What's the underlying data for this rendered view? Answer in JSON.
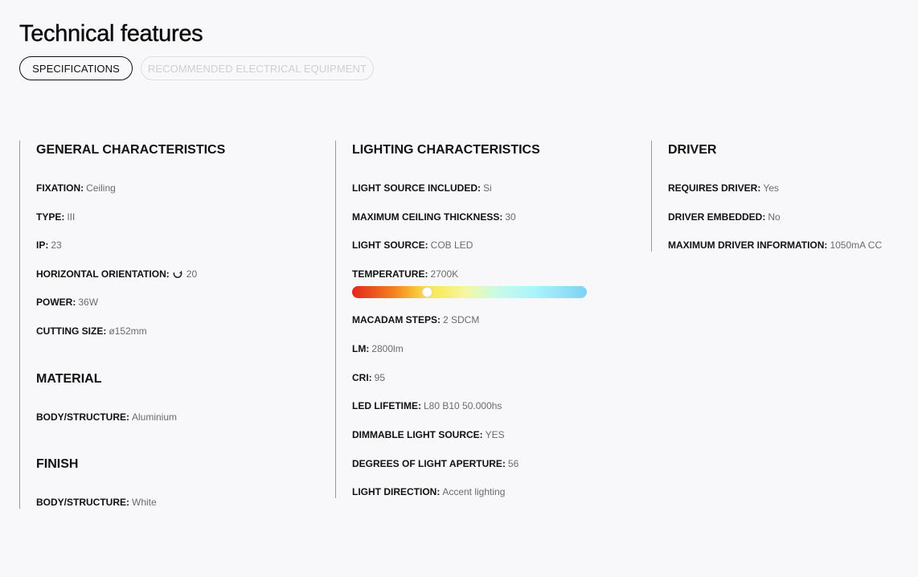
{
  "header": {
    "title": "Technical features"
  },
  "tabs": [
    {
      "label": "SPECIFICATIONS",
      "active": true
    },
    {
      "label": "RECOMMENDED ELECTRICAL EQUIPMENT",
      "active": false
    }
  ],
  "general": {
    "title": "GENERAL CHARACTERISTICS",
    "rows": [
      {
        "key": "FIXATION:",
        "value": "Ceiling"
      },
      {
        "key": "TYPE:",
        "value": "III"
      },
      {
        "key": "IP:",
        "value": "23"
      },
      {
        "key": "HORIZONTAL ORIENTATION:",
        "value": "20",
        "icon": "rotate-icon"
      },
      {
        "key": "POWER:",
        "value": "36W"
      },
      {
        "key": "CUTTING SIZE:",
        "value": "ø152mm"
      }
    ]
  },
  "material": {
    "title": "MATERIAL",
    "rows": [
      {
        "key": "BODY/STRUCTURE:",
        "value": "Aluminium"
      }
    ]
  },
  "finish": {
    "title": "FINISH",
    "rows": [
      {
        "key": "BODY/STRUCTURE:",
        "value": "White"
      }
    ]
  },
  "lighting": {
    "title": "LIGHTING CHARACTERISTICS",
    "rows": [
      {
        "key": "LIGHT SOURCE INCLUDED:",
        "value": "Si"
      },
      {
        "key": "MAXIMUM CEILING THICKNESS:",
        "value": "30"
      },
      {
        "key": "LIGHT SOURCE:",
        "value": "COB LED"
      },
      {
        "key": "TEMPERATURE:",
        "value": "2700K"
      },
      {
        "key": "MACADAM STEPS:",
        "value": "2 SDCM"
      },
      {
        "key": "LM:",
        "value": "2800lm"
      },
      {
        "key": "CRI:",
        "value": "95"
      },
      {
        "key": "LED LIFETIME:",
        "value": "L80 B10 50.000hs"
      },
      {
        "key": "DIMMABLE LIGHT SOURCE:",
        "value": "YES"
      },
      {
        "key": "DEGREES OF LIGHT APERTURE:",
        "value": "56"
      },
      {
        "key": "LIGHT DIRECTION:",
        "value": "Accent lighting"
      }
    ],
    "temperature_scale": {
      "position_fraction": 0.32
    }
  },
  "driver": {
    "title": "DRIVER",
    "rows": [
      {
        "key": "REQUIRES DRIVER:",
        "value": "Yes"
      },
      {
        "key": "DRIVER EMBEDDED:",
        "value": "No"
      },
      {
        "key": "MAXIMUM DRIVER INFORMATION:",
        "value": "1050mA CC"
      }
    ]
  },
  "colors": {
    "accent": "#111111",
    "value_text": "#6b6b6b",
    "background": "#f8f8fa"
  }
}
